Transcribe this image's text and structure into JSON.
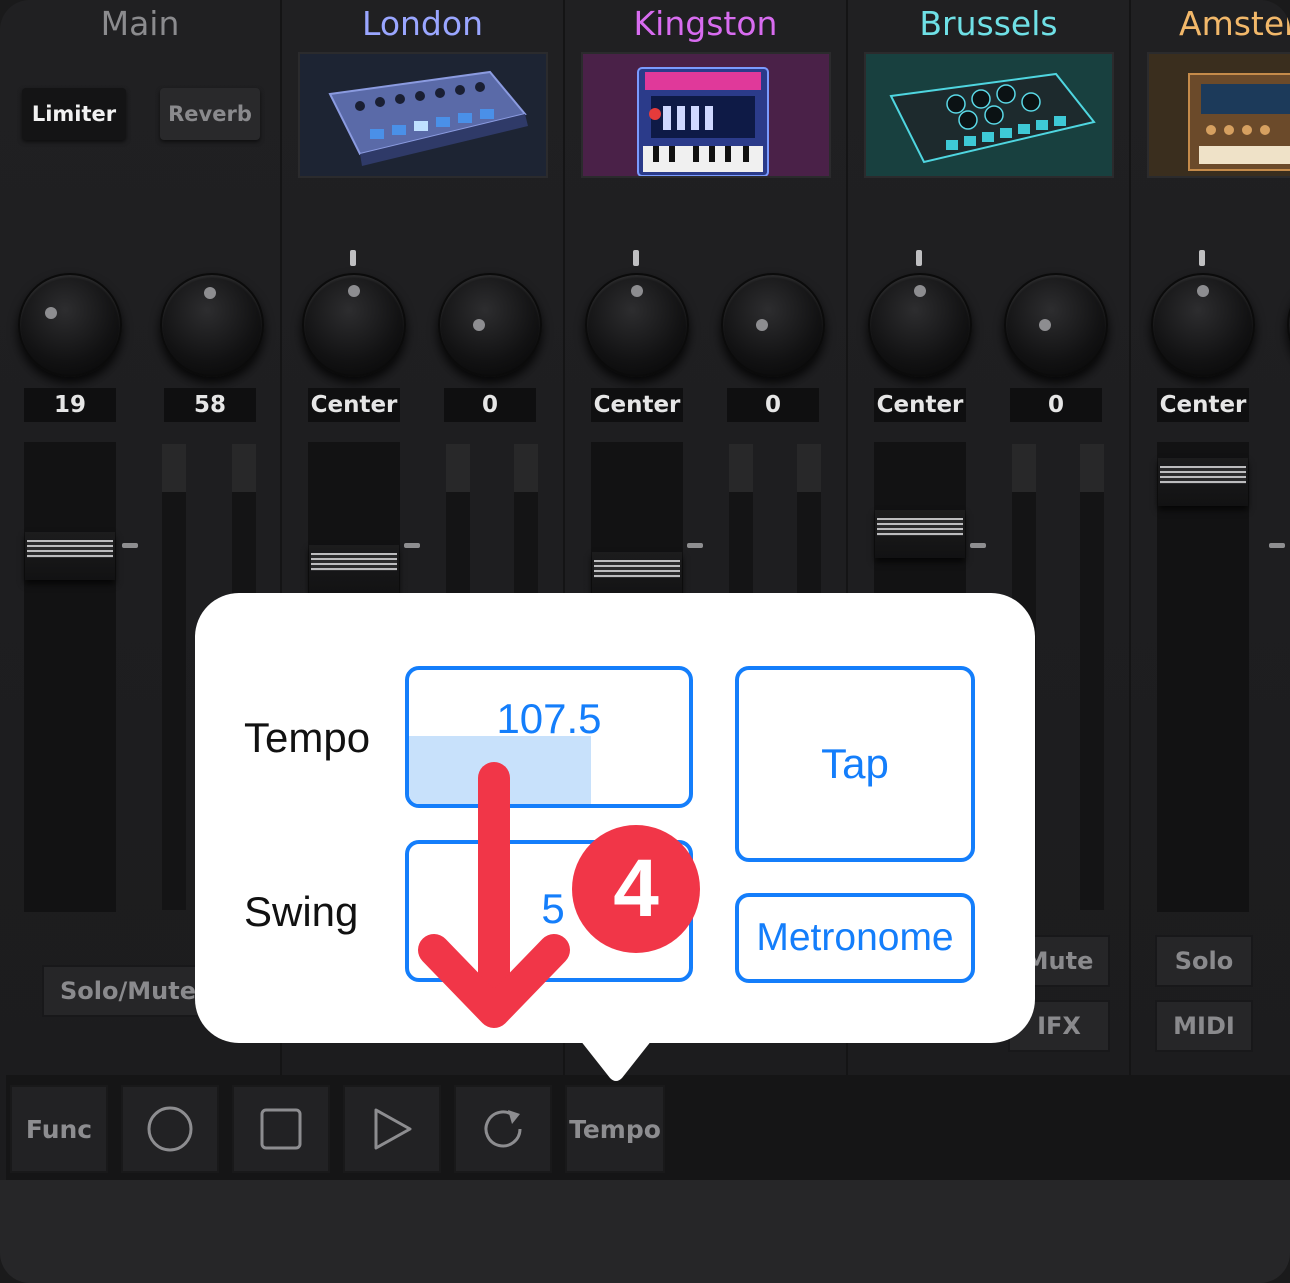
{
  "strips": {
    "main": {
      "title": "Main",
      "title_color": "#8b8b8e",
      "fx_buttons": [
        "Limiter",
        "Reverb"
      ],
      "knob_values": [
        "19",
        "58"
      ],
      "solo_mute_label": "Solo/Mute C"
    },
    "london": {
      "title": "London",
      "title_color": "#9aa6ff",
      "pan": "Center",
      "send": "0"
    },
    "kingston": {
      "title": "Kingston",
      "title_color": "#d86cf0",
      "pan": "Center",
      "send": "0"
    },
    "brussels": {
      "title": "Brussels",
      "title_color": "#6fe0e6",
      "pan": "Center",
      "send": "0",
      "mute_label": "Mute",
      "ifx_label": "IFX"
    },
    "amsterdam": {
      "title": "Amster",
      "title_color": "#f2b86a",
      "pan": "Center",
      "solo_label": "Solo",
      "midi_label": "MIDI"
    }
  },
  "transport": {
    "func_label": "Func",
    "record_icon": "record-icon",
    "stop_icon": "stop-icon",
    "play_icon": "play-icon",
    "loop_icon": "loop-icon",
    "tempo_label": "Tempo"
  },
  "popover": {
    "tempo_label": "Tempo",
    "tempo_value": "107.5",
    "tempo_fill_fraction": 0.65,
    "swing_label": "Swing",
    "swing_value": "5",
    "tap_label": "Tap",
    "metronome_label": "Metronome",
    "accent_color": "#147efb"
  },
  "annotation": {
    "step_number": "4",
    "badge_color": "#f13648",
    "arrow_direction": "down"
  }
}
